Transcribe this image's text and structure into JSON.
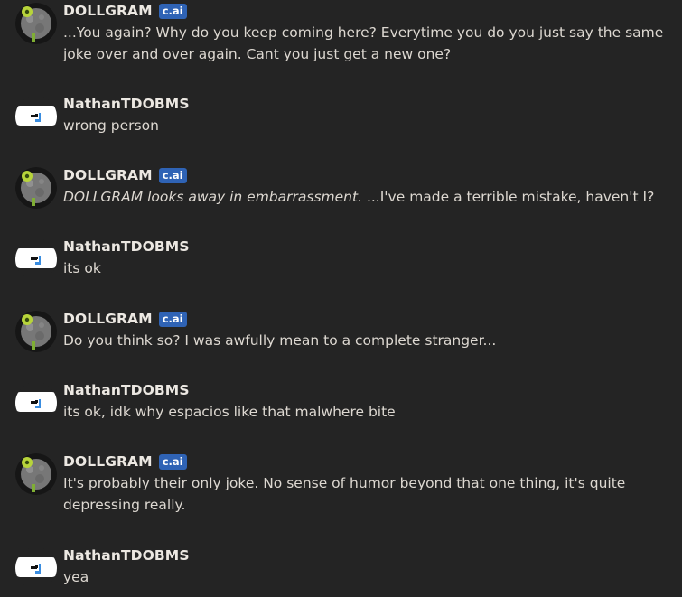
{
  "badge_label": "c.ai",
  "messages": [
    {
      "author": "DOLLGRAM",
      "bot": true,
      "action": "",
      "text": "...You again? Why do you keep coming here? Everytime you do you just say the same joke over and over again. Cant you just get a new one?"
    },
    {
      "author": "NathanTDOBMS",
      "bot": false,
      "action": "",
      "text": "wrong person"
    },
    {
      "author": "DOLLGRAM",
      "bot": true,
      "action": "DOLLGRAM looks away in embarrassment.",
      "text": " ...I've made a terrible mistake, haven't I?"
    },
    {
      "author": "NathanTDOBMS",
      "bot": false,
      "action": "",
      "text": "its ok"
    },
    {
      "author": "DOLLGRAM",
      "bot": true,
      "action": "",
      "text": "Do you think so? I was awfully mean to a complete stranger..."
    },
    {
      "author": "NathanTDOBMS",
      "bot": false,
      "action": "",
      "text": "its ok, idk why espacios like that malwhere bite"
    },
    {
      "author": "DOLLGRAM",
      "bot": true,
      "action": "",
      "text": "It's probably their only joke. No sense of humor beyond that one thing, it's quite depressing really."
    },
    {
      "author": "NathanTDOBMS",
      "bot": false,
      "action": "",
      "text": "yea"
    }
  ]
}
